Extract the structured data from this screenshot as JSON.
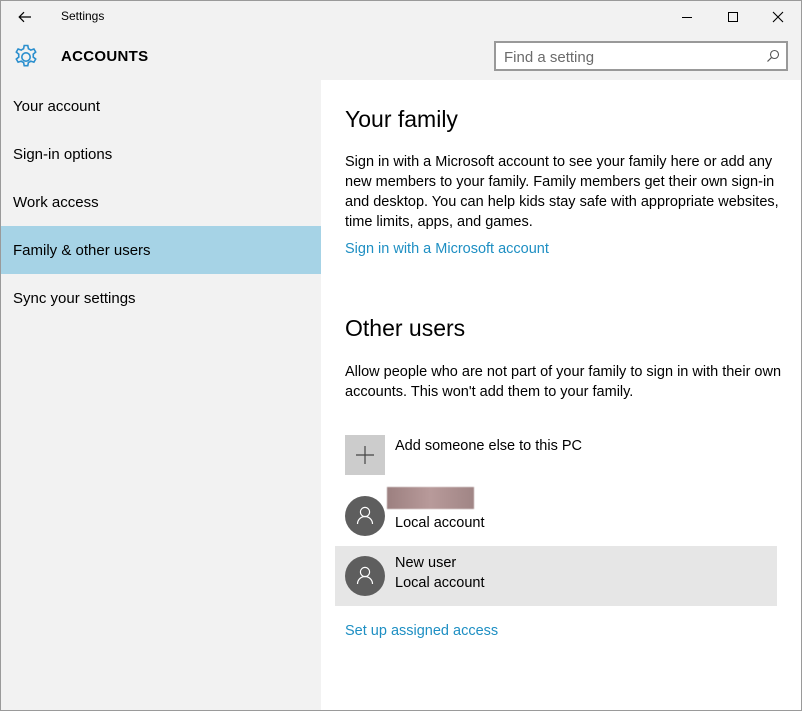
{
  "window": {
    "title": "Settings"
  },
  "header": {
    "title": "ACCOUNTS",
    "search_placeholder": "Find a setting"
  },
  "sidebar": {
    "items": [
      {
        "label": "Your account"
      },
      {
        "label": "Sign-in options"
      },
      {
        "label": "Work access"
      },
      {
        "label": "Family & other users",
        "selected": true
      },
      {
        "label": "Sync your settings"
      }
    ]
  },
  "family": {
    "heading": "Your family",
    "description": "Sign in with a Microsoft account to see your family here or add any new members to your family. Family members get their own sign-in and desktop. You can help kids stay safe with appropriate websites, time limits, apps, and games.",
    "link": "Sign in with a Microsoft account"
  },
  "other_users": {
    "heading": "Other users",
    "description": "Allow people who are not part of your family to sign in with their own accounts. This won't add them to your family.",
    "add_label": "Add someone else to this PC",
    "users": [
      {
        "name": "",
        "type": "Local account"
      },
      {
        "name": "New user",
        "type": "Local account"
      }
    ],
    "assigned_access_link": "Set up assigned access"
  },
  "colors": {
    "accent": "#1e8fc3",
    "selected_nav": "#a6d3e6",
    "gear": "#2b8fce"
  }
}
